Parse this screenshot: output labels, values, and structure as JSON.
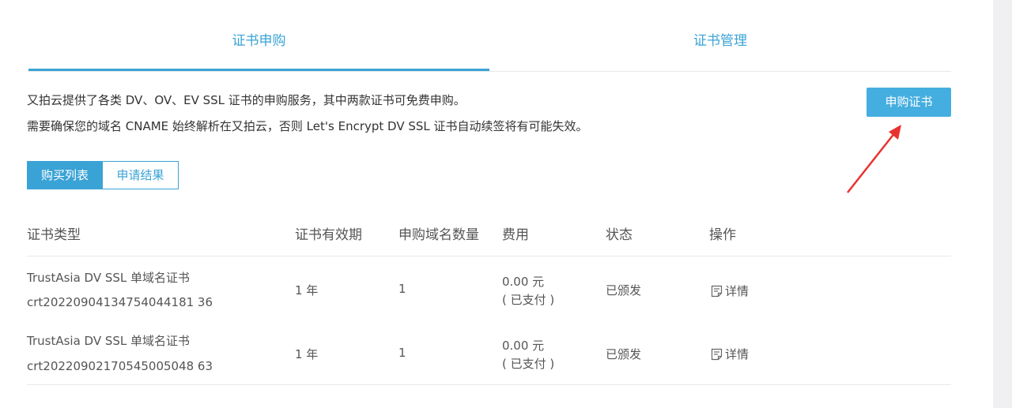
{
  "tabs": {
    "purchase": "证书申购",
    "manage": "证书管理"
  },
  "intro": {
    "line1": "又拍云提供了各类 DV、OV、EV SSL 证书的申购服务，其中两款证书可免费申购。",
    "line2": "需要确保您的域名 CNAME 始终解析在又拍云，否则 Let's Encrypt DV SSL 证书自动续签将有可能失效。"
  },
  "buy_button": "申购证书",
  "subtabs": {
    "list": "购买列表",
    "results": "申请结果"
  },
  "table": {
    "headers": [
      "证书类型",
      "证书有效期",
      "申购域名数量",
      "费用",
      "状态",
      "操作"
    ],
    "rows": [
      {
        "type": "TrustAsia DV SSL 单域名证书",
        "id": "crt20220904134754044181 36",
        "validity": "1 年",
        "domains": "1",
        "fee": "0.00 元",
        "paid": "( 已支付 )",
        "status": "已颁发",
        "action": "详情"
      },
      {
        "type": "TrustAsia DV SSL 单域名证书",
        "id": "crt20220902170545005048 63",
        "validity": "1 年",
        "domains": "1",
        "fee": "0.00 元",
        "paid": "( 已支付 )",
        "status": "已颁发",
        "action": "详情"
      }
    ]
  },
  "colors": {
    "accent": "#3aa3d6",
    "button": "#45aee0",
    "arrow": "#e8322f"
  }
}
